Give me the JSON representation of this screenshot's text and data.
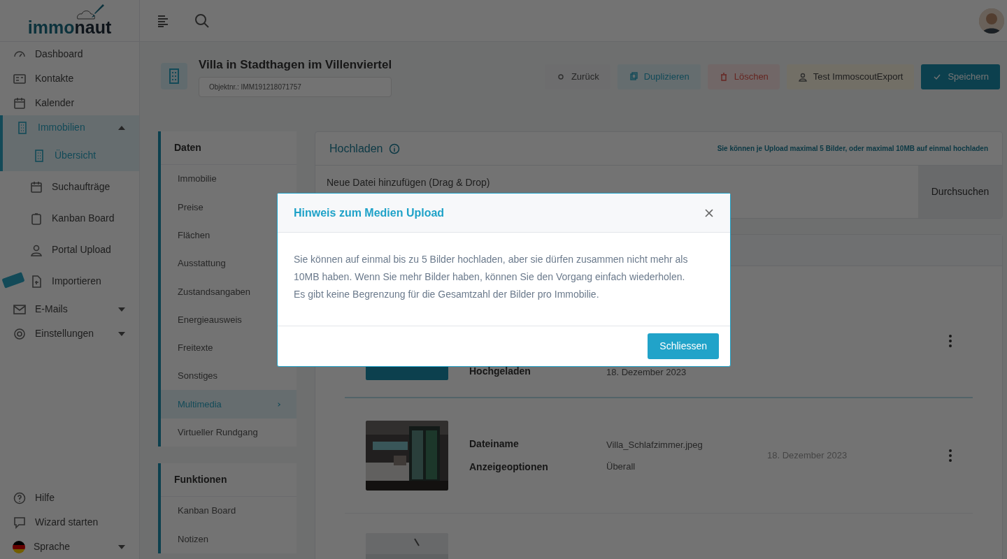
{
  "logo": {
    "primary": "immo",
    "accent": "naut"
  },
  "sidebar": {
    "items": [
      {
        "kind": "item",
        "label": "Dashboard",
        "selected": false
      },
      {
        "kind": "item",
        "label": "Kontakte",
        "selected": false
      },
      {
        "kind": "item",
        "label": "Kalender",
        "selected": false
      },
      {
        "kind": "group",
        "label": "Immobilien",
        "selected": true,
        "expanded": true,
        "children": [
          {
            "label": "Übersicht",
            "selected": true,
            "flag": false
          },
          {
            "label": "Suchaufträge",
            "selected": false,
            "flag": false
          },
          {
            "label": "Kanban Board",
            "selected": false,
            "flag": false
          },
          {
            "label": "Portal Upload",
            "selected": false,
            "flag": false
          },
          {
            "label": "Importieren",
            "selected": false,
            "flag": true
          }
        ]
      },
      {
        "kind": "group",
        "label": "E-Mails",
        "selected": false,
        "expanded": false
      },
      {
        "kind": "group",
        "label": "Einstellungen",
        "selected": false,
        "expanded": false
      }
    ],
    "bottom": [
      {
        "kind": "item",
        "label": "Hilfe"
      },
      {
        "kind": "item",
        "label": "Wizard starten"
      },
      {
        "kind": "group",
        "label": "Sprache",
        "expanded": false
      }
    ]
  },
  "header": {
    "title": "Villa in Stadthagen im Villenviertel",
    "object_number": "Objektnr.: IMM191218071757",
    "buttons": [
      {
        "kind": "plain",
        "label": "Zurück"
      },
      {
        "kind": "info",
        "label": "Duplizieren"
      },
      {
        "kind": "danger",
        "label": "Löschen"
      },
      {
        "kind": "warning",
        "label": "Test ImmoscoutExport"
      },
      {
        "kind": "primary",
        "label": "Speichern"
      }
    ]
  },
  "subnav": [
    {
      "title": "Daten",
      "items": [
        {
          "label": "Immobilie",
          "selected": false
        },
        {
          "label": "Preise",
          "selected": false
        },
        {
          "label": "Flächen",
          "selected": false
        },
        {
          "label": "Ausstattung",
          "selected": false
        },
        {
          "label": "Zustandsangaben",
          "selected": false
        },
        {
          "label": "Energieausweis",
          "selected": false
        },
        {
          "label": "Freitexte",
          "selected": false
        },
        {
          "label": "Sonstiges",
          "selected": false
        },
        {
          "label": "Multimedia",
          "selected": true
        },
        {
          "label": "Virtueller Rundgang",
          "selected": false
        }
      ]
    },
    {
      "title": "Funktionen",
      "items": [
        {
          "label": "Kanban Board",
          "selected": false
        },
        {
          "label": "Notizen",
          "selected": false
        }
      ]
    }
  ],
  "upload": {
    "title": "Hochladen",
    "note": "Sie können je Upload maximal 5 Bilder, oder maximal 10MB auf einmal hochladen",
    "dropzone": {
      "placeholder": "Neue Datei hinzufügen (Drag & Drop)"
    },
    "browse_button": "Durchsuchen"
  },
  "media": [
    {
      "kind": "cover",
      "fields": [
        {
          "label": "Hochgeladen",
          "value": "18. Dezember 2023"
        }
      ]
    },
    {
      "kind": "picture",
      "fields": [
        {
          "label": "Dateiname",
          "value": "Villa_Schlafzimmer.jpeg"
        },
        {
          "label": "Anzeigeoptionen",
          "value": "Überall"
        }
      ],
      "date": "18. Dezember 2023"
    },
    {
      "kind": "picture"
    }
  ],
  "modal": {
    "title": "Hinweis zum Medien Upload",
    "body": [
      "Sie können auf einmal bis zu 5 Bilder hochladen, aber sie dürfen zusammen nicht mehr als",
      "10MB haben. Wenn Sie mehr Bilder haben, können Sie den Vorgang einfach wiederholen.",
      "Es gibt keine Begrenzung für die Gesamtzahl der Bilder pro Immobilie."
    ],
    "close_button": "Schliessen"
  }
}
